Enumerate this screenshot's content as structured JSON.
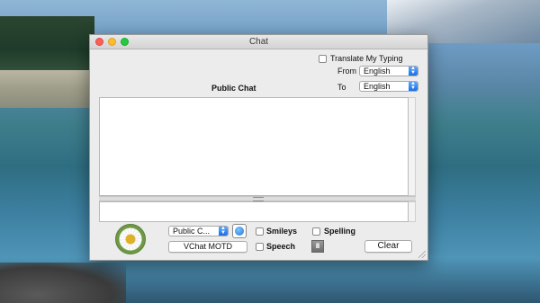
{
  "window": {
    "title": "Chat"
  },
  "header": {
    "translate_label": "Translate My Typing",
    "from_label": "From",
    "to_label": "To",
    "from_value": "English",
    "to_value": "English",
    "public_chat_label": "Public Chat"
  },
  "controls": {
    "room_select": "Public C...",
    "motd_button": "VChat MOTD",
    "smileys_label": "Smileys",
    "speech_label": "Speech",
    "spelling_label": "Spelling",
    "clear_button": "Clear"
  },
  "icons": {
    "smiley": "smiley-face-icon",
    "photo": "user-photo-icon",
    "avatar": "daisy-avatar-icon"
  },
  "colors": {
    "close": "#fc5f57",
    "minimize": "#fdbc2e",
    "maximize": "#28c840",
    "popup_arrow": "#1a6ee6"
  }
}
